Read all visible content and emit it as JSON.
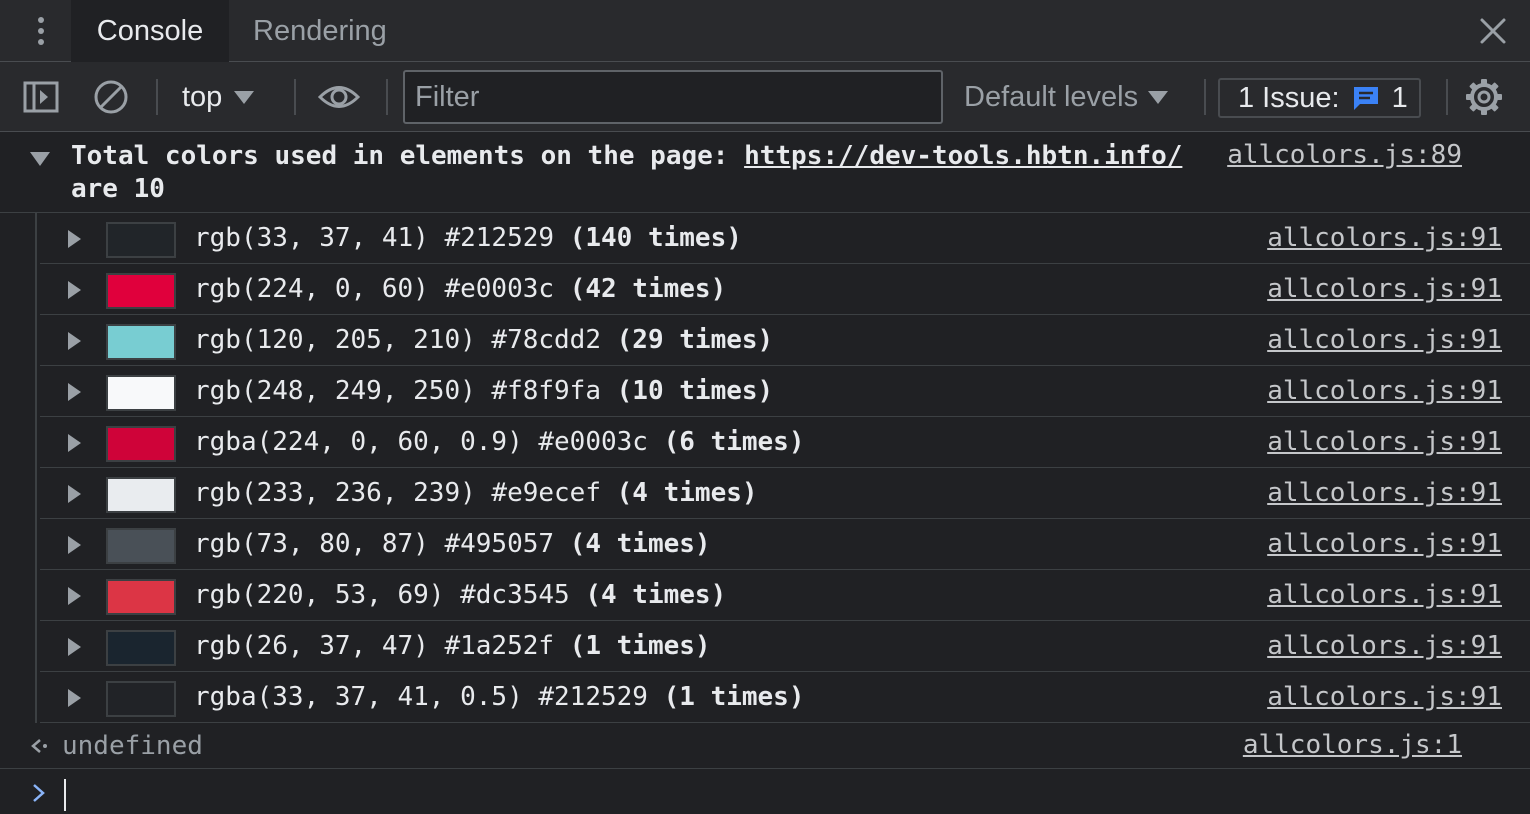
{
  "tabs": [
    {
      "label": "Console",
      "active": true
    },
    {
      "label": "Rendering",
      "active": false
    }
  ],
  "toolbar": {
    "context": "top",
    "filter_placeholder": "Filter",
    "levels": "Default levels",
    "issues_label": "1 Issue:",
    "issues_count": "1"
  },
  "group": {
    "text_before": "Total colors used in elements on the page: ",
    "url": "https://dev-tools.hbtn.info/",
    "text_after": " are 10",
    "source": "allcolors.js:89"
  },
  "entries": [
    {
      "color": "#212529",
      "text": "rgb(33, 37, 41) #212529",
      "count": "(140 times)",
      "source": "allcolors.js:91"
    },
    {
      "color": "#e0003c",
      "text": "rgb(224, 0, 60) #e0003c",
      "count": "(42 times)",
      "source": "allcolors.js:91"
    },
    {
      "color": "#78cdd2",
      "text": "rgb(120, 205, 210) #78cdd2",
      "count": "(29 times)",
      "source": "allcolors.js:91"
    },
    {
      "color": "#f8f9fa",
      "text": "rgb(248, 249, 250) #f8f9fa",
      "count": "(10 times)",
      "source": "allcolors.js:91"
    },
    {
      "color": "#cf0339",
      "text": "rgba(224, 0, 60, 0.9) #e0003c",
      "count": "(6 times)",
      "source": "allcolors.js:91"
    },
    {
      "color": "#e9ecef",
      "text": "rgb(233, 236, 239) #e9ecef",
      "count": "(4 times)",
      "source": "allcolors.js:91"
    },
    {
      "color": "#495057",
      "text": "rgb(73, 80, 87) #495057",
      "count": "(4 times)",
      "source": "allcolors.js:91"
    },
    {
      "color": "#dc3545",
      "text": "rgb(220, 53, 69) #dc3545",
      "count": "(4 times)",
      "source": "allcolors.js:91"
    },
    {
      "color": "#1a252f",
      "text": "rgb(26, 37, 47) #1a252f",
      "count": "(1 times)",
      "source": "allcolors.js:91"
    },
    {
      "color": "#212327",
      "text": "rgba(33, 37, 41, 0.5) #212529",
      "count": "(1 times)",
      "source": "allcolors.js:91"
    }
  ],
  "result": {
    "value": "undefined",
    "source": "allcolors.js:1"
  },
  "colors": {
    "accent_blue": "#8ab4f8",
    "issue_icon": "#3b82f6",
    "panel_bg": "#202124",
    "toolbar_bg": "#292a2d"
  },
  "icons": [
    "kebab-menu-icon",
    "close-icon",
    "sidebar-toggle-icon",
    "clear-console-icon",
    "eye-icon",
    "message-icon",
    "gear-icon",
    "return-arrow-icon",
    "prompt-chevron-icon"
  ]
}
